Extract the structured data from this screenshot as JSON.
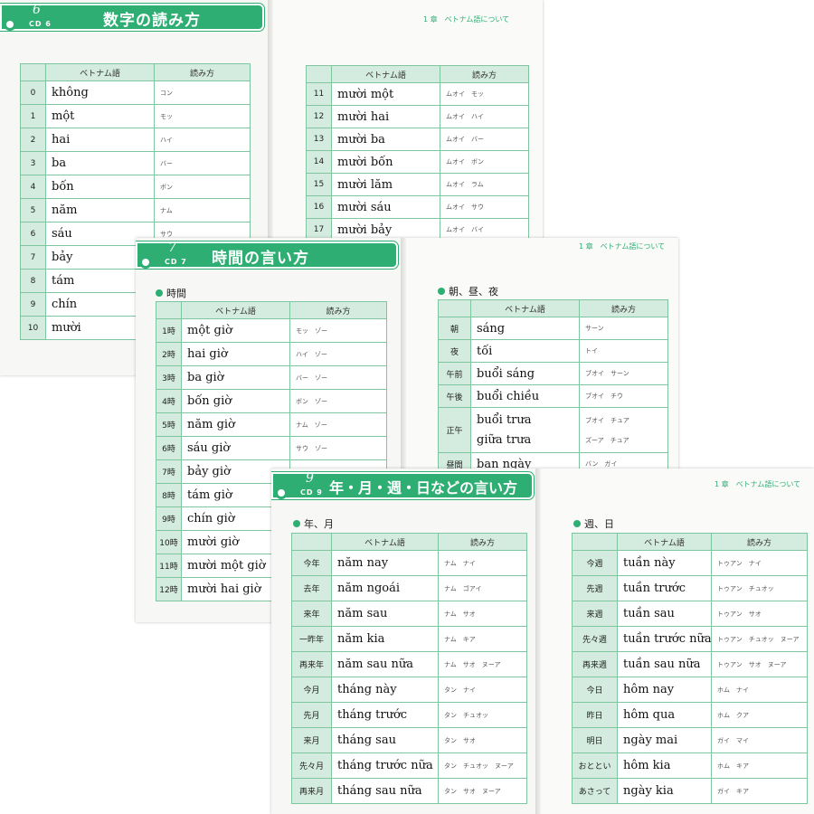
{
  "header_col": "ベトナム語",
  "reading_col": "読み方",
  "running_head": "1 章　ベトナム語について",
  "sec6": {
    "num": "6",
    "cd": "CD 6",
    "title": "数字の読み方",
    "left_rows": [
      {
        "k": "0",
        "v": "không",
        "r": "コン"
      },
      {
        "k": "1",
        "v": "một",
        "r": "モッ"
      },
      {
        "k": "2",
        "v": "hai",
        "r": "ハイ"
      },
      {
        "k": "3",
        "v": "ba",
        "r": "バー"
      },
      {
        "k": "4",
        "v": "bốn",
        "r": "ボン"
      },
      {
        "k": "5",
        "v": "năm",
        "r": "ナム"
      },
      {
        "k": "6",
        "v": "sáu",
        "r": "サウ"
      },
      {
        "k": "7",
        "v": "bảy",
        "r": ""
      },
      {
        "k": "8",
        "v": "tám",
        "r": ""
      },
      {
        "k": "9",
        "v": "chín",
        "r": ""
      },
      {
        "k": "10",
        "v": "mười",
        "r": ""
      }
    ],
    "right_rows": [
      {
        "k": "11",
        "v": "mười một",
        "r": "ムオイ　モッ"
      },
      {
        "k": "12",
        "v": "mười hai",
        "r": "ムオイ　ハイ"
      },
      {
        "k": "13",
        "v": "mười ba",
        "r": "ムオイ　バー"
      },
      {
        "k": "14",
        "v": "mười bốn",
        "r": "ムオイ　ボン"
      },
      {
        "k": "15",
        "v": "mười lăm",
        "r": "ムオイ　ラム"
      },
      {
        "k": "16",
        "v": "mười sáu",
        "r": "ムオイ　サウ"
      },
      {
        "k": "17",
        "v": "mười bảy",
        "r": "ムオイ　バイ"
      }
    ]
  },
  "sec7": {
    "num": "7",
    "cd": "CD 7",
    "title": "時間の言い方",
    "left_label": "時間",
    "left_rows": [
      {
        "k": "1時",
        "v": "một giờ",
        "r": "モッ　ゾー"
      },
      {
        "k": "2時",
        "v": "hai giờ",
        "r": "ハイ　ゾー"
      },
      {
        "k": "3時",
        "v": "ba giờ",
        "r": "バー　ゾー"
      },
      {
        "k": "4時",
        "v": "bốn giờ",
        "r": "ボン　ゾー"
      },
      {
        "k": "5時",
        "v": "năm giờ",
        "r": "ナム　ゾー"
      },
      {
        "k": "6時",
        "v": "sáu giờ",
        "r": "サウ　ゾー"
      },
      {
        "k": "7時",
        "v": "bảy giờ",
        "r": "バイ　ゾー"
      },
      {
        "k": "8時",
        "v": "tám giờ",
        "r": ""
      },
      {
        "k": "9時",
        "v": "chín giờ",
        "r": ""
      },
      {
        "k": "10時",
        "v": "mười giờ",
        "r": ""
      },
      {
        "k": "11時",
        "v": "mười một giờ",
        "r": ""
      },
      {
        "k": "12時",
        "v": "mười hai giờ",
        "r": ""
      }
    ],
    "right_label": "朝、昼、夜",
    "right_rows": [
      {
        "k": "朝",
        "v": "sáng",
        "r": "サーン"
      },
      {
        "k": "夜",
        "v": "tối",
        "r": "トイ"
      },
      {
        "k": "午前",
        "v": "buổi sáng",
        "r": "ブオイ　サーン"
      },
      {
        "k": "午後",
        "v": "buổi chiều",
        "r": "ブオイ　チウ"
      },
      {
        "k": "正午",
        "v": "buổi trưa",
        "r": "ブオイ　チュア",
        "v2": "giữa trưa",
        "r2": "ズーア　チュア"
      },
      {
        "k": "昼間",
        "v": "ban ngày",
        "r": "バン　ガイ"
      }
    ]
  },
  "sec9": {
    "num": "9",
    "cd": "CD 9",
    "title": "年・月・週・日などの言い方",
    "left_label": "年、月",
    "left_rows": [
      {
        "k": "今年",
        "v": "năm nay",
        "r": "ナム　ナイ"
      },
      {
        "k": "去年",
        "v": "năm ngoái",
        "r": "ナム　ゴアイ"
      },
      {
        "k": "来年",
        "v": "năm sau",
        "r": "ナム　サオ"
      },
      {
        "k": "一昨年",
        "v": "năm kia",
        "r": "ナム　キア"
      },
      {
        "k": "再来年",
        "v": "năm sau nữa",
        "r": "ナム　サオ　ヌーア"
      },
      {
        "k": "今月",
        "v": "tháng này",
        "r": "タン　ナイ"
      },
      {
        "k": "先月",
        "v": "tháng trước",
        "r": "タン　チュオッ"
      },
      {
        "k": "来月",
        "v": "tháng sau",
        "r": "タン　サオ"
      },
      {
        "k": "先々月",
        "v": "tháng trước nữa",
        "r": "タン　チュオッ　ヌーア"
      },
      {
        "k": "再来月",
        "v": "tháng sau nữa",
        "r": "タン　サオ　ヌーア"
      }
    ],
    "right_label": "週、日",
    "right_rows": [
      {
        "k": "今週",
        "v": "tuần này",
        "r": "トゥアン　ナイ"
      },
      {
        "k": "先週",
        "v": "tuần trước",
        "r": "トゥアン　チュオッ"
      },
      {
        "k": "来週",
        "v": "tuần sau",
        "r": "トゥアン　サオ"
      },
      {
        "k": "先々週",
        "v": "tuần trước nữa",
        "r": "トゥアン　チュオッ　ヌーア"
      },
      {
        "k": "再来週",
        "v": "tuần sau nữa",
        "r": "トゥアン　サオ　ヌーア"
      },
      {
        "k": "今日",
        "v": "hôm nay",
        "r": "ホム　ナイ"
      },
      {
        "k": "昨日",
        "v": "hôm qua",
        "r": "ホム　クア"
      },
      {
        "k": "明日",
        "v": "ngày mai",
        "r": "ガイ　マイ"
      },
      {
        "k": "おととい",
        "v": "hôm kia",
        "r": "ホム　キア"
      },
      {
        "k": "あさって",
        "v": "ngày kia",
        "r": "ガイ　キア"
      }
    ]
  }
}
